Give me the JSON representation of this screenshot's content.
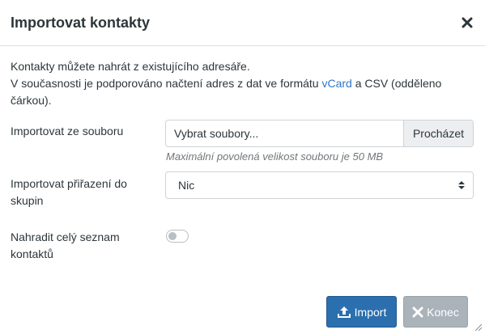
{
  "dialog": {
    "title": "Importovat kontakty",
    "close_icon": "close-icon"
  },
  "intro": {
    "line1": "Kontakty můžete nahrát z existujícího adresáře.",
    "line2_before": "V současnosti je podporováno načtení adres z dat ve formátu ",
    "link_vcard": "vCard",
    "line2_after": " a CSV (odděleno čárkou)."
  },
  "form": {
    "file": {
      "label": "Importovat ze souboru",
      "value": "Vybrat soubory...",
      "browse_label": "Procházet",
      "hint": "Maximální povolená velikost souboru je 50 MB"
    },
    "groups": {
      "label": "Importovat přiřazení do skupin",
      "selected": "Nic"
    },
    "replace": {
      "label": "Nahradit celý seznam kontaktů",
      "enabled": false
    }
  },
  "buttons": {
    "import_label": "Import",
    "close_label": "Konec"
  },
  "colors": {
    "primary": "#2b6fae",
    "secondary": "#aab3ba",
    "link": "#2f77c7"
  }
}
